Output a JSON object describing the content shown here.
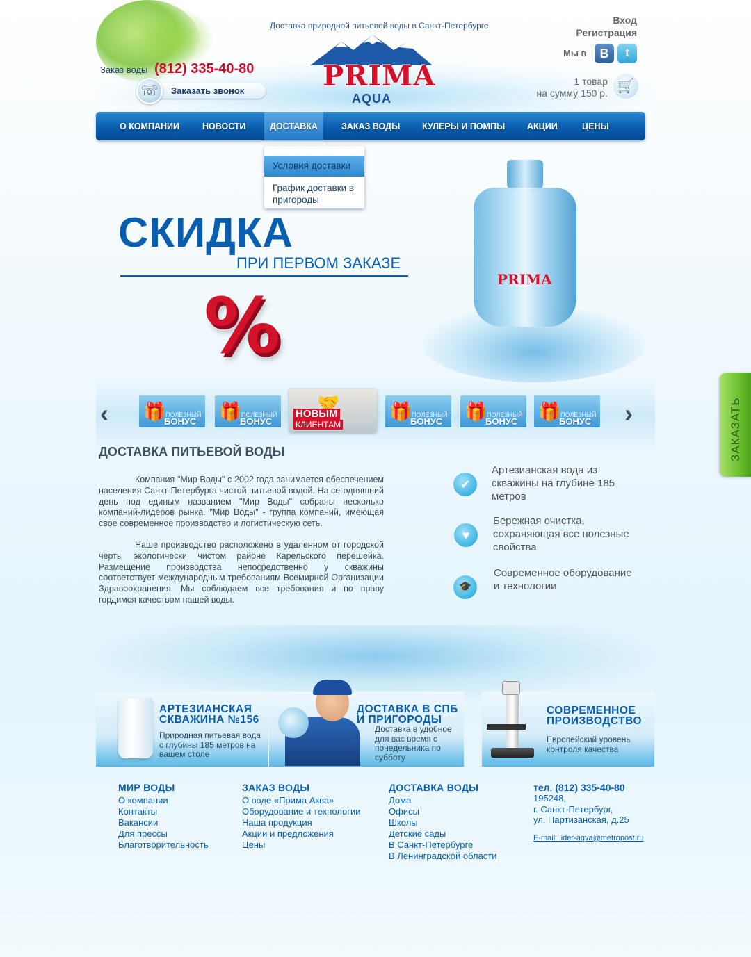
{
  "header": {
    "tagline": "Доставка природной питьевой воды в Санкт-Петербурге",
    "logo": {
      "line1": "PRIMA",
      "line2": "AQUA"
    },
    "order_label": "Заказ воды",
    "order_phone": "(812) 335-40-80",
    "callback_label": "Заказать звонок",
    "login": "Вход",
    "register": "Регистрация",
    "social_label": "Мы в",
    "social": [
      {
        "icon": "vk-icon",
        "glyph": "В"
      },
      {
        "icon": "twitter-icon",
        "glyph": "t"
      }
    ],
    "cart_line1": "1 товар",
    "cart_line2": "на сумму 150 р."
  },
  "nav": {
    "items": [
      {
        "label": "О КОМПАНИИ"
      },
      {
        "label": "НОВОСТИ"
      },
      {
        "label": "ДОСТАВКА"
      },
      {
        "label": "ЗАКАЗ ВОДЫ"
      },
      {
        "label": "КУЛЕРЫ И ПОМПЫ"
      },
      {
        "label": "АКЦИИ"
      },
      {
        "label": "ЦЕНЫ"
      }
    ],
    "active_index": 2,
    "dropdown": [
      {
        "label": "Условия доставки"
      },
      {
        "label": "График доставки в пригороды"
      }
    ]
  },
  "banner": {
    "headline": "СКИДКА",
    "subheadline": "ПРИ ПЕРВОМ ЗАКАЗЕ",
    "percent_sign": "%",
    "bottle_logo": "PRIMA"
  },
  "slider": {
    "prev": "‹",
    "next": "›",
    "thumbs": [
      {
        "line1": "ПОЛЕЗНЫЙ",
        "line2": "БОНУС"
      },
      {
        "line1": "ПОЛЕЗНЫЙ",
        "line2": "БОНУС"
      },
      {
        "line1": "НОВЫМ",
        "line2": "КЛИЕНТАМ"
      },
      {
        "line1": "ПОЛЕЗНЫЙ",
        "line2": "БОНУС"
      },
      {
        "line1": "ПОЛЕЗНЫЙ",
        "line2": "БОНУС"
      },
      {
        "line1": "ПОЛЕЗНЫЙ",
        "line2": "БОНУС"
      }
    ]
  },
  "about": {
    "title": "ДОСТАВКА ПИТЬЕВОЙ ВОДЫ",
    "paragraphs": [
      "Компания \"Мир Воды\" с 2002 года занимается обеспечением населения Санкт-Петербурга чистой питьевой водой. На сегодняшний день под единым названием \"Мир Воды\" собраны несколько компаний-лидеров рынка. \"Мир Воды\" - группа компаний, имеющая свое современное производство и логистическую сеть.",
      "Наше производство расположено в удаленном от городской черты экологически чистом районе Карельского перешейка. Размещение производства непосредственно у скважины соответствует международным требованиям Всемирной Организации Здравоохранения. Мы соблюдаем все требования и по праву гордимся качеством нашей воды."
    ],
    "features": [
      {
        "icon": "check-icon",
        "glyph": "✔",
        "text": "Артезианская вода из скважины на глубине 185 метров"
      },
      {
        "icon": "heart-icon",
        "glyph": "♥",
        "text": "Бережная очистка, сохраняющая все полезные свойства"
      },
      {
        "icon": "graduation-cap-icon",
        "glyph": "🎓",
        "text": "Современное оборудование и технологии"
      }
    ]
  },
  "promos": [
    {
      "title": "АРТЕЗИАНСКАЯ СКВАЖИНА №156",
      "text": "Природная питьевая вода с глубины 185 метров на вашем столе"
    },
    {
      "title": "ДОСТАВКА В СПБ И ПРИГОРОДЫ",
      "text": "Доставка в удобное для вас время с понедельника по субботу"
    },
    {
      "title": "СОВРЕМЕННОЕ ПРОИЗВОДСТВО",
      "text": "Европейский уровень контроля качества"
    }
  ],
  "footer": {
    "columns": [
      {
        "title": "МИР ВОДЫ",
        "links": [
          "О компании",
          "Контакты",
          "Вакансии",
          "Для прессы",
          "Благотворительность"
        ]
      },
      {
        "title": "ЗАКАЗ ВОДЫ",
        "links": [
          "О воде «Прима Аква»",
          "Оборудование и технологии",
          "Наша продукция",
          "Акции и предложения",
          "Цены"
        ]
      },
      {
        "title": "ДОСТАВКА ВОДЫ",
        "links": [
          "Дома",
          "Офисы",
          "Школы",
          "Детские сады",
          "В Санкт-Петербурге",
          "В Ленинградской области"
        ]
      }
    ],
    "contact": {
      "phone": "тел. (812) 335-40-80",
      "zip": "195248,",
      "city": "г. Санкт-Петербург,",
      "street": "ул. Партизанская, д.25",
      "email": "E-mail: lider-aqva@metropost.ru"
    }
  },
  "side_tab": {
    "label": "ЗАКАЗАТЬ"
  },
  "colors": {
    "brand_blue": "#0a5eaf",
    "brand_red": "#d4112b",
    "side_tab_green": "#6cc12e"
  }
}
